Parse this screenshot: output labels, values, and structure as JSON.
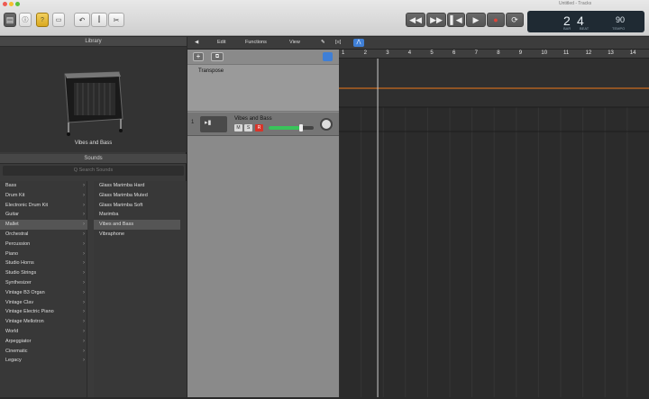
{
  "window": {
    "title": "Untitled - Tracks"
  },
  "toolbar": {
    "left_buttons": [
      "library-icon",
      "inspector-icon",
      "quick-help-icon",
      "toolbar-icon"
    ],
    "tool_buttons": [
      "undo-icon",
      "mixer-icon",
      "scissors-icon"
    ],
    "transport": [
      "rewind-icon",
      "fast-forward-icon",
      "go-to-start-icon",
      "play-icon",
      "record-icon",
      "cycle-icon"
    ]
  },
  "lcd": {
    "bar": "2",
    "beat": "4",
    "bar_label": "BAR",
    "beat_label": "BEAT",
    "tempo": "90",
    "tempo_label": "TEMPO"
  },
  "library": {
    "header": "Library",
    "patch_name": "Vibes and Bass",
    "sounds_header": "Sounds",
    "search_placeholder": "Q  Search Sounds",
    "categories": [
      "Bass",
      "Drum Kit",
      "Electronic Drum Kit",
      "Guitar",
      "Mallet",
      "Orchestral",
      "Percussion",
      "Piano",
      "Studio Horns",
      "Studio Strings",
      "Synthesizer",
      "Vintage B3 Organ",
      "Vintage Clav",
      "Vintage Electric Piano",
      "Vintage Mellotron",
      "World",
      "Arpeggiator",
      "Cinematic",
      "Legacy"
    ],
    "selected_category_index": 4,
    "patches": [
      "Glass Marimba Hard",
      "Glass Marimba Muted",
      "Glass Marimba Soft",
      "Marimba",
      "Vibes and Bass",
      "Vibraphone"
    ],
    "selected_patch_index": 4
  },
  "tracks": {
    "menus": [
      "Edit",
      "Functions",
      "View"
    ],
    "global_track": "Transpose",
    "track_number": "1",
    "track_name": "Vibes and Bass",
    "mute_label": "M",
    "solo_label": "S",
    "record_label": "R",
    "add_label": "+",
    "ruler": [
      "1",
      "2",
      "3",
      "4",
      "5",
      "6",
      "7",
      "8",
      "9",
      "10",
      "11",
      "12",
      "13",
      "14"
    ],
    "playhead_bar": 2.75
  },
  "colors": {
    "accent": "#3f7fd6",
    "record": "#d9342a",
    "volume": "#39c35a",
    "transpose_line": "#c96a1e",
    "lcd_bg": "#1f2a33"
  }
}
